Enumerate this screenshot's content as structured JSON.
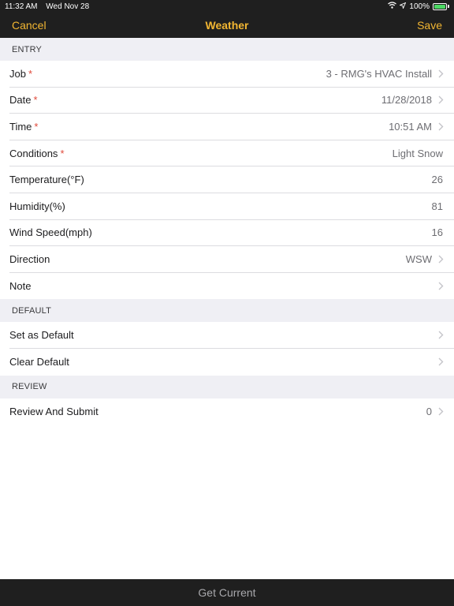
{
  "status": {
    "time": "11:32 AM",
    "date": "Wed Nov 28",
    "battery": "100%"
  },
  "nav": {
    "cancel": "Cancel",
    "title": "Weather",
    "save": "Save"
  },
  "sections": {
    "entry": "ENTRY",
    "default": "DEFAULT",
    "review": "REVIEW"
  },
  "entry_rows": {
    "job": {
      "label": "Job",
      "value": "3 - RMG's HVAC Install"
    },
    "date": {
      "label": "Date",
      "value": "11/28/2018"
    },
    "time": {
      "label": "Time",
      "value": "10:51 AM"
    },
    "conditions": {
      "label": "Conditions",
      "value": "Light Snow"
    },
    "temperature": {
      "label": "Temperature(°F)",
      "value": "26"
    },
    "humidity": {
      "label": "Humidity(%)",
      "value": "81"
    },
    "wind_speed": {
      "label": "Wind Speed(mph)",
      "value": "16"
    },
    "direction": {
      "label": "Direction",
      "value": "WSW"
    },
    "note": {
      "label": "Note",
      "value": ""
    }
  },
  "required_marker": "*",
  "default_rows": {
    "set_default": "Set as Default",
    "clear_default": "Clear Default"
  },
  "review_rows": {
    "review_submit": {
      "label": "Review And Submit",
      "value": "0"
    }
  },
  "bottom": {
    "get_current": "Get Current"
  },
  "colors": {
    "accent": "#f2b632",
    "required": "#e0493a",
    "bar_background": "#1f1f1f",
    "section_background": "#efeff4"
  }
}
